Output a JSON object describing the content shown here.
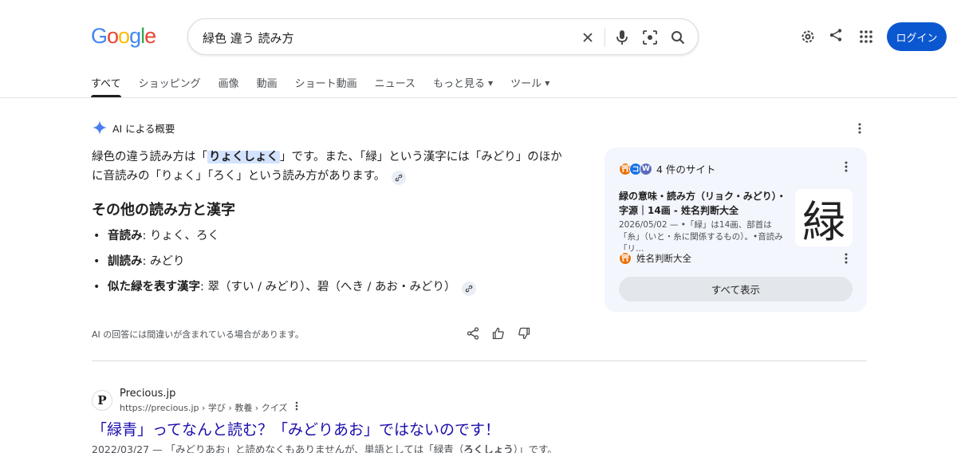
{
  "logo": {
    "text": "Google"
  },
  "search": {
    "query": "緑色 違う 読み方"
  },
  "header": {
    "login_label": "ログイン"
  },
  "tabs": [
    {
      "label": "すべて",
      "active": true
    },
    {
      "label": "ショッピング"
    },
    {
      "label": "画像"
    },
    {
      "label": "動画"
    },
    {
      "label": "ショート動画"
    },
    {
      "label": "ニュース"
    },
    {
      "label": "もっと見る",
      "dropdown": true
    },
    {
      "label": "ツール",
      "dropdown": true
    }
  ],
  "ai_overview": {
    "heading": "AI による概要",
    "p1_a": "緑色の違う読み方は「",
    "p1_hl": "りょくしょく",
    "p1_b": "」です。また、「緑」という漢字には「みどり」のほか",
    "p1_c": "に音読みの「りょく」「ろく」という読み方があります。",
    "h2": "その他の読み方と漢字",
    "items": [
      {
        "term": "音読み",
        "text": ": りょく、ろく"
      },
      {
        "term": "訓読み",
        "text": ": みどり"
      },
      {
        "term": "似た緑を表す漢字",
        "text": ": 翠（すい / みどり）、碧（へき / あお・みどり）"
      }
    ],
    "disclaimer": "AI の回答には間違いが含まれている場合があります。"
  },
  "sources_panel": {
    "count_label": "4 件のサイト",
    "source_title": "緑の意味・読み方（リョク・みどり）・字源｜14画 - 姓名判断大全",
    "source_snippet": "2026/05/02 — •「緑」は14画、部首は「糸」（いと・糸に関係するもの）。•音読み「リ…",
    "thumb_char": "緑",
    "site_name": "姓名判断大全",
    "show_all_label": "すべて表示"
  },
  "result": {
    "favicon_letter": "P",
    "site": "Precious.jp",
    "url": "https://precious.jp › 学び › 教養 › クイズ",
    "title": "「緑青」ってなんと読む？「みどりあお」ではないのです！",
    "snippet_a": "2022/03/27 — 「みどりあお」と読めなくもありませんが、単語としては「緑青（",
    "snippet_b": "ろくしょう",
    "snippet_c": "）」です。"
  },
  "colors": {
    "accent": "#0b57d0",
    "link": "#1a0dab",
    "panel_bg": "#f3f6fc",
    "highlight": "#d3e3fd"
  }
}
